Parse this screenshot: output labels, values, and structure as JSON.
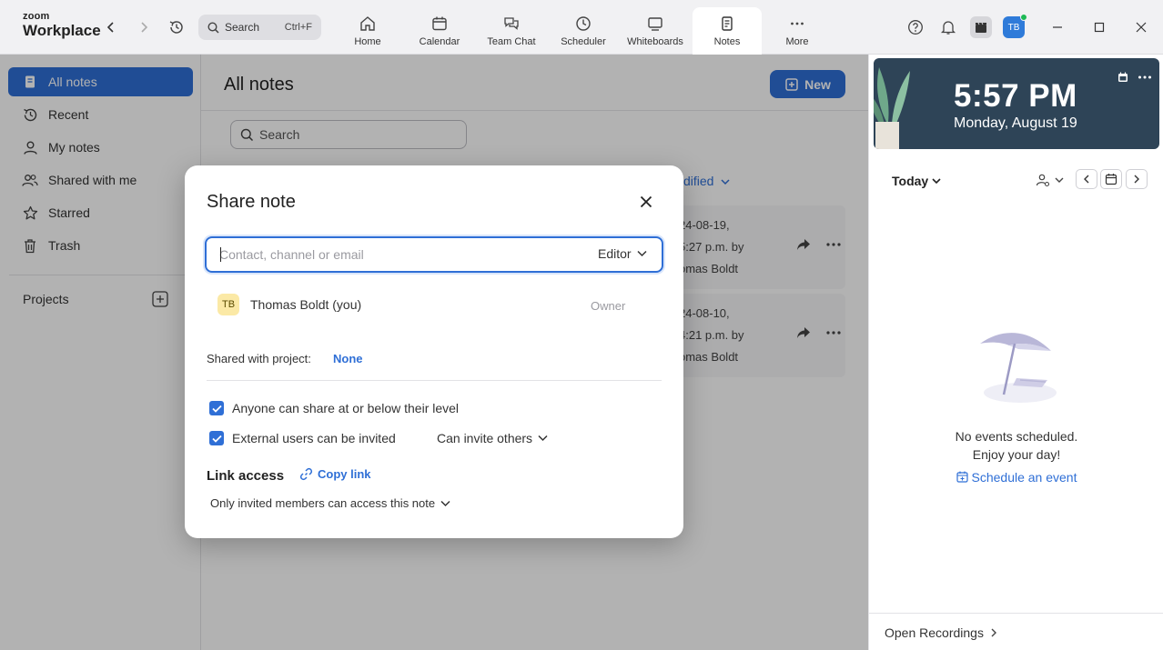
{
  "app": {
    "logo_line1": "zoom",
    "logo_line2": "Workplace"
  },
  "topbar": {
    "search_label": "Search",
    "search_shortcut": "Ctrl+F",
    "tabs": [
      {
        "label": "Home"
      },
      {
        "label": "Calendar"
      },
      {
        "label": "Team Chat"
      },
      {
        "label": "Scheduler"
      },
      {
        "label": "Whiteboards"
      },
      {
        "label": "Notes"
      },
      {
        "label": "More"
      }
    ],
    "active_tab": "Notes",
    "avatar_initials": "TB",
    "accent_color": "#2f6fd6"
  },
  "sidebar": {
    "items": [
      {
        "label": "All notes"
      },
      {
        "label": "Recent"
      },
      {
        "label": "My notes"
      },
      {
        "label": "Shared with me"
      },
      {
        "label": "Starred"
      },
      {
        "label": "Trash"
      }
    ],
    "projects_label": "Projects"
  },
  "main": {
    "title": "All notes",
    "new_button": "New",
    "search_placeholder": "Search",
    "sort_label": "dified",
    "notes": [
      {
        "line1": "24-08-19,",
        "line2": "5:27 p.m. by",
        "line3": "omas Boldt"
      },
      {
        "line1": "24-08-10,",
        "line2": "4:21 p.m. by",
        "line3": "omas Boldt"
      }
    ]
  },
  "right_panel": {
    "time": "5:57 PM",
    "date": "Monday, August 19",
    "today_label": "Today",
    "empty_line1": "No events scheduled.",
    "empty_line2": "Enjoy your day!",
    "schedule_link": "Schedule an event",
    "footer_label": "Open Recordings"
  },
  "modal": {
    "title": "Share note",
    "input_placeholder": "Contact, channel or email",
    "role_select": "Editor",
    "user_initials": "TB",
    "user_name": "Thomas Boldt  (you)",
    "user_role": "Owner",
    "shared_project_label": "Shared with project:",
    "shared_project_value": "None",
    "option1": "Anyone can share at or below their level",
    "option2": "External users can be invited",
    "invite_select": "Can invite others",
    "link_access_label": "Link access",
    "copy_link": "Copy link",
    "access_select": "Only invited members can access this note"
  }
}
